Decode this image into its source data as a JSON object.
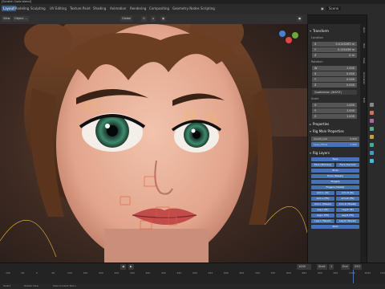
{
  "title": "[Scratch Code.blend]",
  "menus": [
    "Layout",
    "Modeling",
    "Sculpting",
    "UV Editing",
    "Texture Paint",
    "Shading",
    "Animation",
    "Rendering",
    "Compositing",
    "Geometry Nodes",
    "Scripting"
  ],
  "active_workspace": "Layout",
  "topbar_right": {
    "scene": "Scene"
  },
  "header": {
    "mode": "Pose Mode",
    "view": "View",
    "select": "Select",
    "object_label": "Object ...",
    "orientation": "Global",
    "pose_options": "Pose Options"
  },
  "npanel": {
    "transform": {
      "title": "Transform",
      "location_label": "Location",
      "location": [
        {
          "axis": "X",
          "value": "0.0145263 m"
        },
        {
          "axis": "Y",
          "value": "0.125436 m"
        },
        {
          "axis": "Z",
          "value": "0 m"
        }
      ],
      "rotation_label": "Rotation",
      "rotation": [
        {
          "axis": "W",
          "value": "1.000"
        },
        {
          "axis": "X",
          "value": "0.000"
        },
        {
          "axis": "Y",
          "value": "0.000"
        },
        {
          "axis": "Z",
          "value": "0.000"
        }
      ],
      "rotation_mode": "Quaternion (WXYZ)",
      "scale_label": "Scale",
      "scale": [
        {
          "axis": "X",
          "value": "1.000"
        },
        {
          "axis": "Y",
          "value": "1.000"
        },
        {
          "axis": "Z",
          "value": "1.000"
        }
      ]
    },
    "properties_title": "Properties",
    "rig_main_title": "Rig Main Properties",
    "rig_props": [
      {
        "label": "mouth_lock",
        "value": "0.000"
      },
      {
        "label": "eyes_follow",
        "value": "1.000"
      }
    ],
    "rig_layers_title": "Rig Layers",
    "rig_layers": [
      [
        "Face"
      ],
      [
        "Face (Primary)",
        "Face (Second"
      ],
      [
        "Torso"
      ],
      [
        "Torso (Tweak)"
      ],
      [
        "Fingers"
      ],
      [
        "Fingers (Detail)"
      ],
      [
        "Arm.L (IK)",
        "Arm.R (IK)"
      ],
      [
        "Arm.L (FK)",
        "Arm.R (FK)"
      ],
      [
        "Arm.L (Tweak)",
        "Arm.R (Tweak)"
      ],
      [
        "Leg.L (IK)",
        "Leg.R (IK)"
      ],
      [
        "Leg.L (FK)",
        "Leg.R (FK)"
      ],
      [
        "Leg.L (Tweak)",
        "Leg.R (Tweak)"
      ],
      [
        "Root"
      ]
    ]
  },
  "vtabs": [
    "Item",
    "Tool",
    "View",
    "Animation",
    "Edit"
  ],
  "timeline": {
    "frames": [
      "-100",
      "-50",
      "0",
      "50",
      "100",
      "150",
      "200",
      "250",
      "300",
      "350",
      "400",
      "450",
      "500",
      "550",
      "600",
      "650",
      "700",
      "750",
      "800",
      "850",
      "900",
      "950",
      "1000",
      "1050",
      "1100"
    ],
    "current_frame": "1000",
    "start": "Start",
    "start_val": "1",
    "end": "End",
    "end_val": "250"
  },
  "status": {
    "left": "Select",
    "middle": "Rotate View",
    "right": "Pose Context Menu"
  },
  "colors": {
    "accent": "#4772b3",
    "viewport_bg": "#4a3428"
  }
}
